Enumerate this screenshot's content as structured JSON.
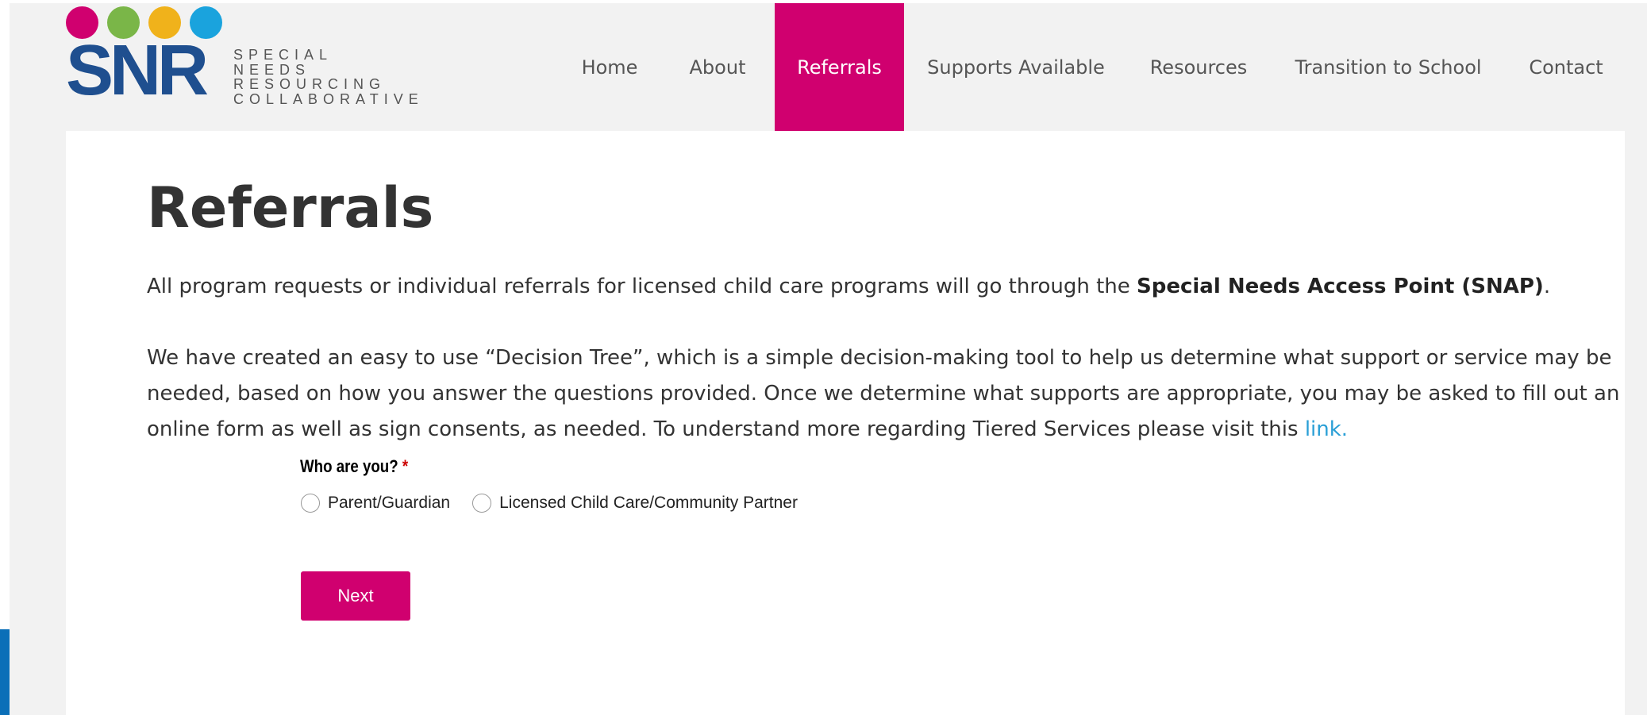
{
  "logo": {
    "brand": "SNR",
    "tagline": [
      "SPECIAL",
      "NEEDS",
      "RESOURCING",
      "COLLABORATIVE"
    ],
    "dot_colors": [
      "#d0006f",
      "#7ab648",
      "#f0b21b",
      "#1aa3dd"
    ],
    "brand_color": "#1f4f8f"
  },
  "nav": {
    "items": [
      {
        "label": "Home"
      },
      {
        "label": "About"
      },
      {
        "label": "Referrals",
        "active": true
      },
      {
        "label": "Supports Available"
      },
      {
        "label": "Resources"
      },
      {
        "label": "Transition to School"
      },
      {
        "label": "Contact"
      }
    ],
    "active_color": "#d0006f"
  },
  "main": {
    "title": "Referrals",
    "para1_text": "All program requests or individual referrals for licensed child care programs will go through the ",
    "para1_bold": "Special Needs Access Point (SNAP)",
    "para1_end": ".",
    "para2_text": "We have created an easy to use “Decision Tree”, which is a simple decision-making tool to help us determine what support or service may be needed, based on how you answer the questions provided.  Once we determine what supports are appropriate, you may be asked to fill out an online form as well as sign consents, as needed.   To understand more regarding Tiered Services please visit this ",
    "para2_link": "link.",
    "link_color": "#2a9fd6"
  },
  "form": {
    "question": "Who are you?",
    "required_marker": "*",
    "options": [
      "Parent/Guardian",
      "Licensed Child Care/Community Partner"
    ],
    "next_label": "Next"
  }
}
